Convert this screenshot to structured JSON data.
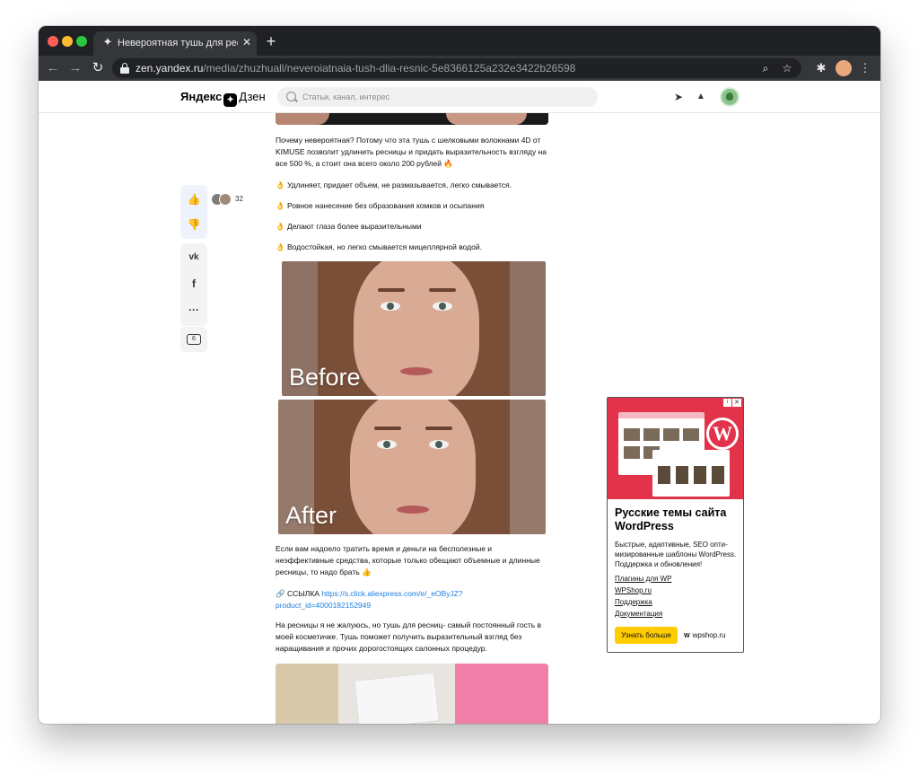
{
  "browser": {
    "tab_title": "Невероятная тушь для ресниц",
    "tab_close": "✕",
    "new_tab": "+",
    "url_host": "zen.yandex.ru",
    "url_path": "/media/zhuzhuall/neveroiatnaia-tush-dlia-resnic-5e8366125a232e3422b26598",
    "icons": {
      "back": "←",
      "forward": "→",
      "reload": "↻",
      "zoom": "⌕",
      "star": "☆",
      "extensions": "✱",
      "menu": "⋮",
      "favicon": "✦"
    }
  },
  "header": {
    "logo_left": "Яндекс",
    "logo_mark": "✦",
    "logo_right": "Дзен",
    "search_placeholder": "Статьи, канал, интерес",
    "send_icon": "➤",
    "bell_icon": "▲"
  },
  "actions": {
    "like_icon": "👍",
    "dislike_icon": "👎",
    "likes_count": "32",
    "vk": "vk",
    "fb": "f",
    "more": "···",
    "comments_count": "6"
  },
  "article": {
    "p1": "Почему невероятная? Потому что эта тушь с шелковыми волокнами 4D от KIMUSE позволит удлинить ресницы и придать выразительность взгляду на все 500 %, а стоит она всего около 200 рублей 🔥",
    "bullet1": "👌 Удлиняет, придает объем, не размазывается, легко смывается.",
    "bullet2": "👌 Ровное нанесение без образования комков и осыпания",
    "bullet3": "👌 Делают глаза более выразительными",
    "bullet4": "👌 Водостойкая, но легко смывается мицеллярной водой.",
    "photo_before": "Before",
    "photo_after": "After",
    "p2": "Если вам надоело тратить время и деньги на бесполезные и неэффективные средства, которые только обещают объемные и длинные ресницы, то надо брать 👍",
    "link_prefix": "🔗 ССЫЛКА ",
    "link_url": "https://s.click.aliexpress.com/e/_eOByJZ?product_id=4000182152949",
    "p3": "На ресницы я не жалуюсь, но тушь для ресниц- самый постоянный гость в моей косметичке. Тушь поможет получить выразительный взгляд без наращивания и прочих дорогостоящих салонных процедур."
  },
  "ad": {
    "wp_mark": "W",
    "close": "✕",
    "info": "i",
    "title": "Русские темы сайта WordPress",
    "description": "Быстрые, адаптивные, SEO опти- мизированные шаблоны WordPress. Поддержка и обновления!",
    "links": [
      "Плагины для WP",
      "WPShop.ru",
      "Поддержка",
      "Документация"
    ],
    "cta": "Узнать больше",
    "domain_mark": "W",
    "domain": "wpshop.ru"
  }
}
